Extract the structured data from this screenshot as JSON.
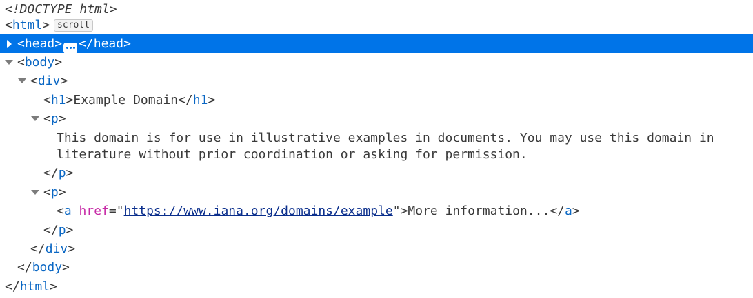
{
  "nodes": {
    "doctype": "<!DOCTYPE html>",
    "html_open": "html",
    "scroll_badge": "scroll",
    "head": "head",
    "body": "body",
    "div": "div",
    "h1": "h1",
    "h1_text": "Example Domain",
    "p": "p",
    "p1_text_line1": "This domain is for use in illustrative examples in documents. You may use this domain in",
    "p1_text_line2": "literature without prior coordination or asking for permission.",
    "a": "a",
    "a_attr_name": "href",
    "a_attr_value": "https://www.iana.org/domains/example",
    "a_text": "More information...",
    "html_close": "html"
  },
  "colors": {
    "selection": "#0074e8",
    "tag_name": "#0a67c4",
    "attr_name": "#c729a6",
    "link": "#0a2e8c"
  },
  "icons": {
    "expanded": "triangle-down-icon",
    "collapsed": "triangle-right-icon",
    "collapsed_content": "ellipsis-icon"
  }
}
